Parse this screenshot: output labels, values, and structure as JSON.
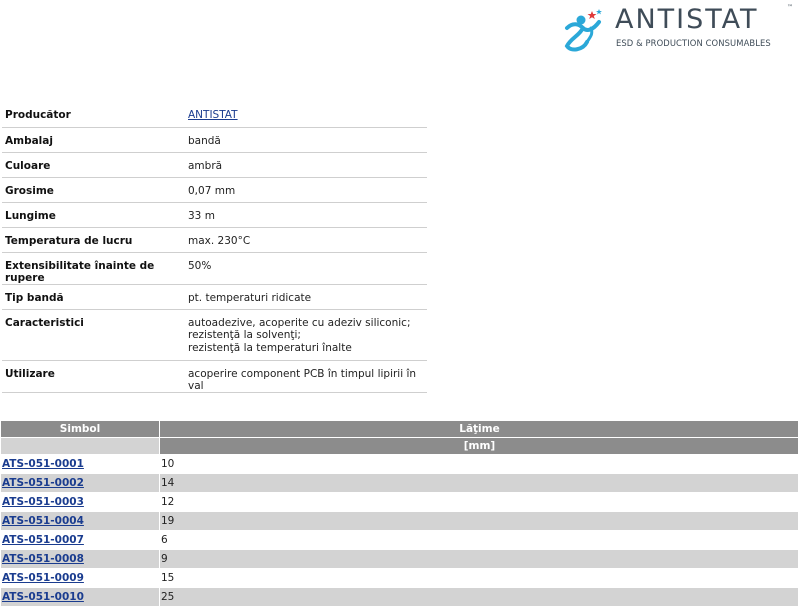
{
  "brand": {
    "name": "ANTISTAT",
    "trademark": "™",
    "tagline": "ESD & PRODUCTION CONSUMABLES"
  },
  "specs": [
    {
      "label": "Producător",
      "value": "ANTISTAT",
      "link": true
    },
    {
      "label": "Ambalaj",
      "value": "bandă"
    },
    {
      "label": "Culoare",
      "value": "ambră"
    },
    {
      "label": "Grosime",
      "value": "0,07 mm"
    },
    {
      "label": "Lungime",
      "value": "33 m"
    },
    {
      "label": "Temperatura de lucru",
      "value": "max. 230°C"
    },
    {
      "label": "Extensibilitate înainte de rupere",
      "value": "50%"
    },
    {
      "label": "Tip bandă",
      "value": "pt. temperaturi ridicate"
    },
    {
      "label": "Caracteristici",
      "lines": [
        "autoadezive, acoperite cu adeziv siliconic;",
        "rezistenţă la solvenţi;",
        "rezistenţă la temperaturi înalte"
      ]
    },
    {
      "label": "Utilizare",
      "value": "acoperire component PCB în timpul lipirii în val"
    }
  ],
  "items_table": {
    "col_symbol": "Simbol",
    "col_width": "Lăţime",
    "col_width_unit": "[mm]",
    "rows": [
      {
        "symbol": "ATS-051-0001",
        "width": "10"
      },
      {
        "symbol": "ATS-051-0002",
        "width": "14"
      },
      {
        "symbol": "ATS-051-0003",
        "width": "12"
      },
      {
        "symbol": "ATS-051-0004",
        "width": "19"
      },
      {
        "symbol": "ATS-051-0007",
        "width": "6"
      },
      {
        "symbol": "ATS-051-0008",
        "width": "9"
      },
      {
        "symbol": "ATS-051-0009",
        "width": "15"
      },
      {
        "symbol": "ATS-051-0010",
        "width": "25"
      }
    ]
  },
  "colors": {
    "link": "#1a3c8f",
    "header_bg": "#8c8c8c",
    "row_alt": "#d3d3d3",
    "logo_blue": "#2ba8d8",
    "logo_red": "#e03a3a"
  }
}
